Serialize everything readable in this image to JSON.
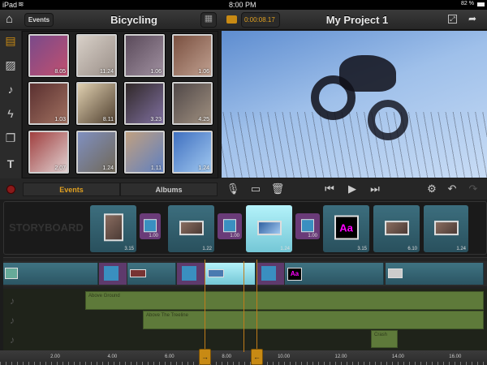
{
  "status": {
    "device": "iPad",
    "time": "8:00 PM",
    "battery": "82 %"
  },
  "header": {
    "back_label": "Events",
    "library_title": "Bicycling",
    "timecode": "0:00:08.17",
    "project_title": "My Project 1"
  },
  "library": {
    "thumbs": [
      {
        "duration": "8.05"
      },
      {
        "duration": "11.24"
      },
      {
        "duration": "1.06"
      },
      {
        "duration": "1.06"
      },
      {
        "duration": "1.03"
      },
      {
        "duration": "8.11"
      },
      {
        "duration": "3.23"
      },
      {
        "duration": "4.25"
      },
      {
        "duration": "2.07"
      },
      {
        "duration": "1.24"
      },
      {
        "duration": "1.11"
      },
      {
        "duration": "1.24"
      }
    ],
    "tabs": {
      "events": "Events",
      "albums": "Albums"
    }
  },
  "storyboard": {
    "label": "STORYBOARD",
    "items": [
      {
        "type": "clip",
        "duration": "3.15"
      },
      {
        "type": "transition",
        "duration": "1.00"
      },
      {
        "type": "clip",
        "duration": "1.22"
      },
      {
        "type": "transition",
        "duration": "1.00"
      },
      {
        "type": "clip",
        "duration": "1.24",
        "selected": true
      },
      {
        "type": "transition",
        "duration": "1.00"
      },
      {
        "type": "title",
        "duration": "3.15",
        "text": "Aa"
      },
      {
        "type": "clip",
        "duration": "6.10"
      },
      {
        "type": "clip",
        "duration": "1.24"
      }
    ]
  },
  "timeline": {
    "title_text": "Aa",
    "audio": [
      "Above Ground",
      "Above The Treeline",
      "Crash"
    ],
    "ruler": [
      "2.00",
      "4.00",
      "6.00",
      "8.00",
      "10.00",
      "12.00",
      "14.00",
      "16.00"
    ]
  },
  "colors": {
    "accent": "#e0a020",
    "clip": "#3c6e7e",
    "transition": "#6a3b78",
    "audio": "#5e7a3a"
  }
}
